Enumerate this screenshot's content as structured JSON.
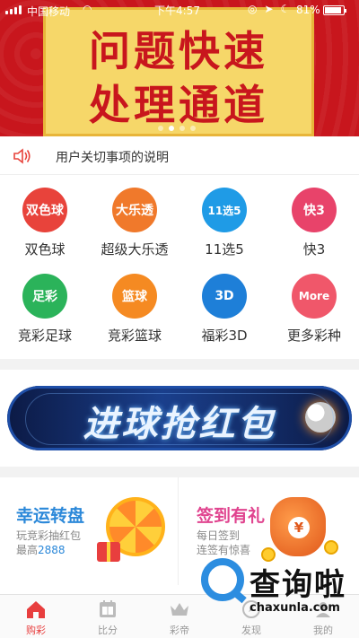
{
  "status_bar": {
    "carrier": "中国移动",
    "wifi_icon": "wifi-icon",
    "time": "下午4:57",
    "battery_percent": "81%"
  },
  "banner": {
    "line1": "问题快速",
    "line2": "处理通道",
    "page_indicator": {
      "count": 4,
      "active": 1
    }
  },
  "notice": {
    "icon": "speaker-icon",
    "text": "用户关切事项的说明"
  },
  "lotteries": [
    {
      "label": "双色球",
      "badge": "双色球",
      "color": "#e8433b"
    },
    {
      "label": "超级大乐透",
      "badge": "大乐透",
      "color": "#f0792b"
    },
    {
      "label": "11选5",
      "badge": "11选5",
      "color": "#1f9be6"
    },
    {
      "label": "快3",
      "badge": "快3",
      "color": "#e8436a"
    },
    {
      "label": "竞彩足球",
      "badge": "足彩",
      "color": "#2bb35a"
    },
    {
      "label": "竞彩篮球",
      "badge": "篮球",
      "color": "#f58a22"
    },
    {
      "label": "福彩3D",
      "badge": "3D",
      "color": "#1e7fd8"
    },
    {
      "label": "更多彩种",
      "badge": "More",
      "color": "#f0576a"
    }
  ],
  "promo": {
    "title": "进球抢红包"
  },
  "cards": {
    "lucky_wheel": {
      "title": "幸运转盘",
      "sub1": "玩竞彩抽红包",
      "sub2_prefix": "最高",
      "sub2_amount": "2888"
    },
    "checkin": {
      "title": "签到有礼",
      "sub1": "每日签到",
      "sub2": "连签有惊喜"
    }
  },
  "tabs": [
    {
      "label": "购彩",
      "icon": "home-icon",
      "active": true
    },
    {
      "label": "比分",
      "icon": "scoreboard-icon",
      "active": false
    },
    {
      "label": "彩帝",
      "icon": "crown-icon",
      "active": false
    },
    {
      "label": "发现",
      "icon": "discover-icon",
      "active": false
    },
    {
      "label": "我的",
      "icon": "profile-icon",
      "active": false
    }
  ],
  "watermark": {
    "text": "查询啦",
    "url": "chaxunla.com"
  },
  "colors": {
    "brand_red": "#c8161d",
    "tab_active": "#e83e3e",
    "link_blue": "#2b88d9",
    "pink": "#e0448f"
  }
}
